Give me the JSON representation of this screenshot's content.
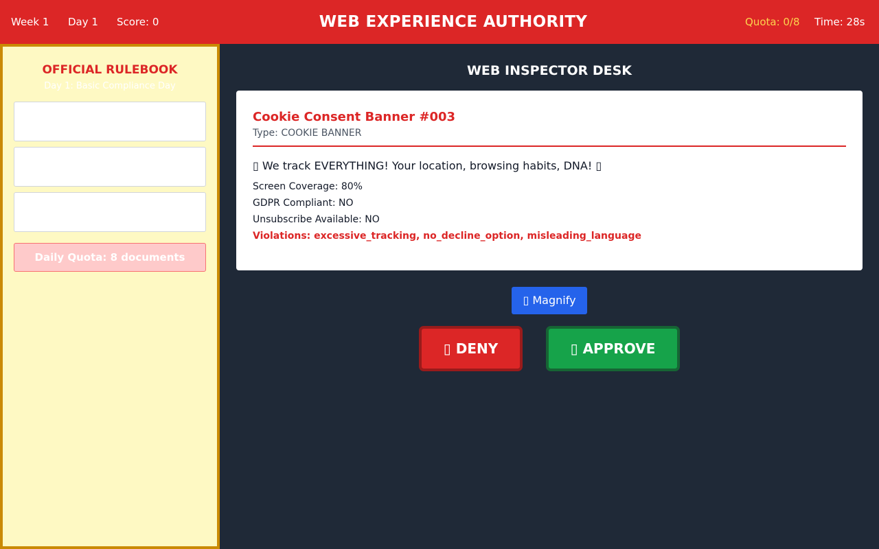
{
  "header": {
    "week": "Week 1",
    "day": "Day 1",
    "score": "Score: 0",
    "title": "WEB EXPERIENCE AUTHORITY",
    "quota": "Quota: 0/8",
    "time": "Time: 28s"
  },
  "rulebook": {
    "title": "OFFICIAL RULEBOOK",
    "subtitle": "Day 1: Basic Compliance Day",
    "rules": [
      "",
      "",
      ""
    ],
    "daily_quota": "Daily Quota: 8 documents"
  },
  "desk": {
    "title": "WEB INSPECTOR DESK"
  },
  "document": {
    "title": "Cookie Consent Banner #003",
    "type": "Type: COOKIE BANNER",
    "message": "▯ We track EVERYTHING! Your location, browsing habits, DNA! ▯",
    "screen_coverage": "Screen Coverage: 80%",
    "gdpr": "GDPR Compliant: NO",
    "unsubscribe": "Unsubscribe Available: NO",
    "violations": "Violations: excessive_tracking, no_decline_option, misleading_language"
  },
  "actions": {
    "magnify_icon": "▯",
    "magnify_label": "Magnify",
    "deny_icon": "▯",
    "deny_label": "DENY",
    "approve_icon": "▯",
    "approve_label": "APPROVE"
  },
  "colors": {
    "header_bg": "#dc2626",
    "rulebook_bg": "#fef9c3",
    "rulebook_border": "#ca8a04",
    "desk_bg": "#1f2937",
    "deny": "#dc2626",
    "approve": "#16a34a",
    "magnify": "#2563eb",
    "quota_text": "#fcd34d"
  }
}
